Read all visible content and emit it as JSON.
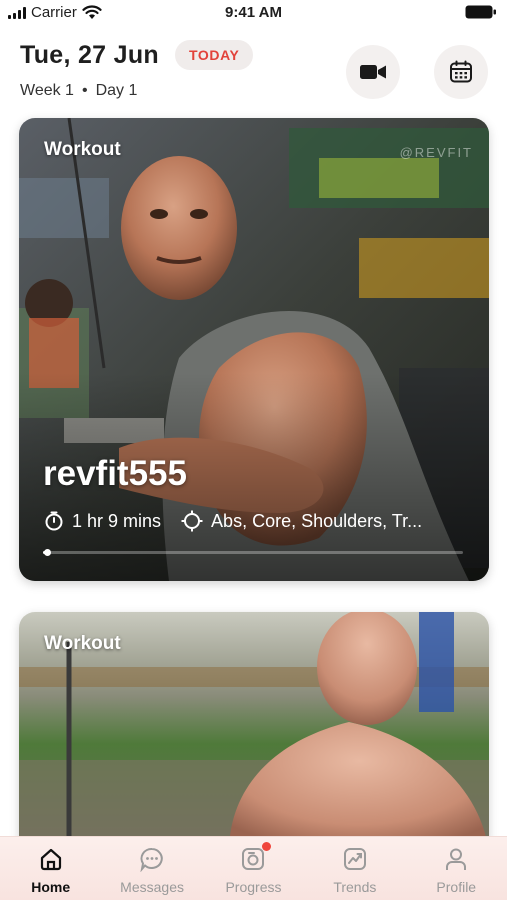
{
  "status_bar": {
    "carrier": "Carrier",
    "time": "9:41 AM",
    "icons": [
      "signal-bars-icon",
      "wifi-icon",
      "battery-icon"
    ]
  },
  "header": {
    "date": "Tue, 27 Jun",
    "today_badge": "TODAY",
    "week": "Week 1",
    "separator": "•",
    "day": "Day 1",
    "actions": [
      "video-camera-icon",
      "calendar-icon"
    ]
  },
  "cards": [
    {
      "label": "Workout",
      "watermark": "@REVFIT",
      "title": "revfit555",
      "duration": "1 hr 9 mins",
      "targets": "Abs, Core, Shoulders, Tr...",
      "progress": 0.01,
      "icons": [
        "timer-icon",
        "target-icon"
      ]
    },
    {
      "label": "Workout"
    }
  ],
  "tab_bar": {
    "tabs": [
      {
        "label": "Home",
        "icon": "home-icon",
        "active": true
      },
      {
        "label": "Messages",
        "icon": "chat-bubble-icon",
        "active": false
      },
      {
        "label": "Progress",
        "icon": "camera-icon",
        "active": false,
        "badge": true
      },
      {
        "label": "Trends",
        "icon": "trend-chart-icon",
        "active": false
      },
      {
        "label": "Profile",
        "icon": "person-icon",
        "active": false
      }
    ]
  },
  "colors": {
    "accent": "#e2423a",
    "badge_bg": "#f0eceb",
    "tab_bar_bg": "#fcefec",
    "badge_dot": "#f0463c"
  }
}
